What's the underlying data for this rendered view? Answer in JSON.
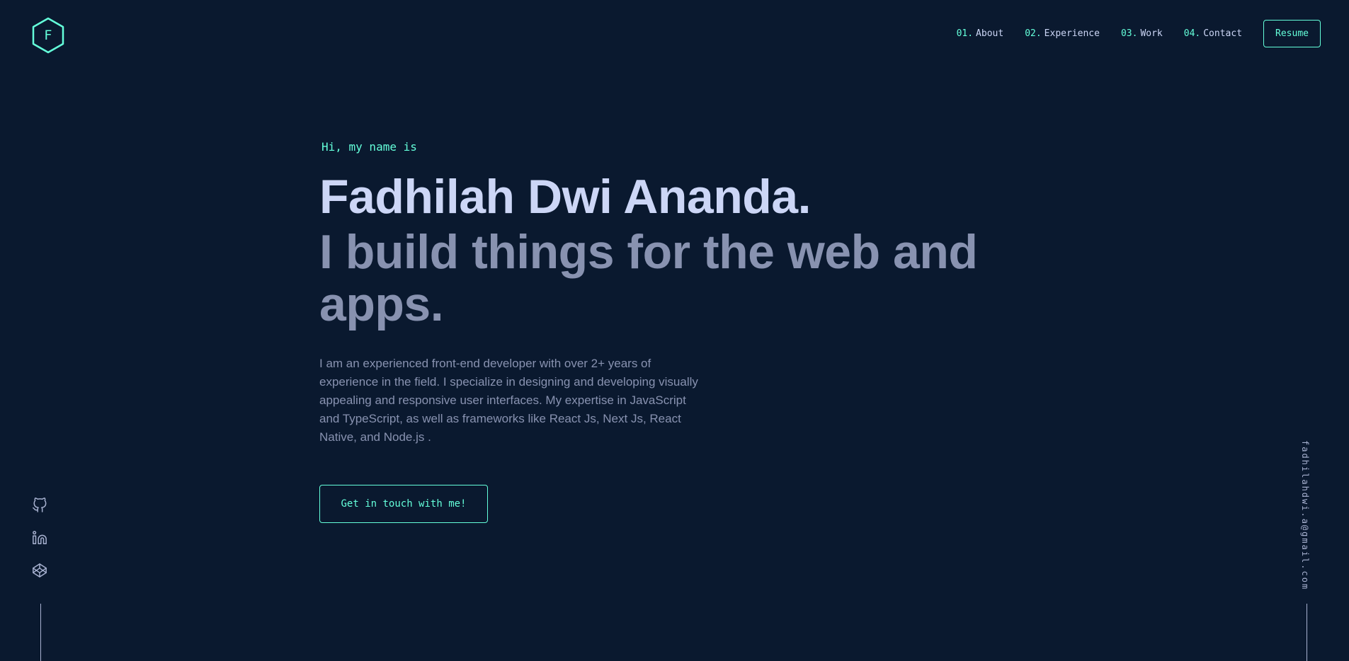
{
  "brand": {
    "logo_letter": "F"
  },
  "nav": {
    "items": [
      {
        "num": "01.",
        "label": "About"
      },
      {
        "num": "02.",
        "label": "Experience"
      },
      {
        "num": "03.",
        "label": "Work"
      },
      {
        "num": "04.",
        "label": "Contact"
      }
    ],
    "resume_label": "Resume"
  },
  "hero": {
    "greeting": "Hi, my name is",
    "name": "Fadhilah Dwi Ananda.",
    "tagline": "I build things for the web and apps.",
    "bio": "I am an experienced front-end developer with over 2+ years of experience in the field. I specialize in designing and developing visually appealing and responsive user interfaces. My expertise in JavaScript and TypeScript, as well as frameworks like React Js, Next Js, React Native, and Node.js .",
    "cta_label": "Get in touch with me!"
  },
  "social": {
    "icons": [
      "github-icon",
      "linkedin-icon",
      "codepen-icon"
    ]
  },
  "email": "fadhilahdwi.a@gmail.com",
  "colors": {
    "background": "#0a192f",
    "accent": "#64ffda",
    "heading": "#ccd6f6",
    "text": "#8892b0"
  }
}
